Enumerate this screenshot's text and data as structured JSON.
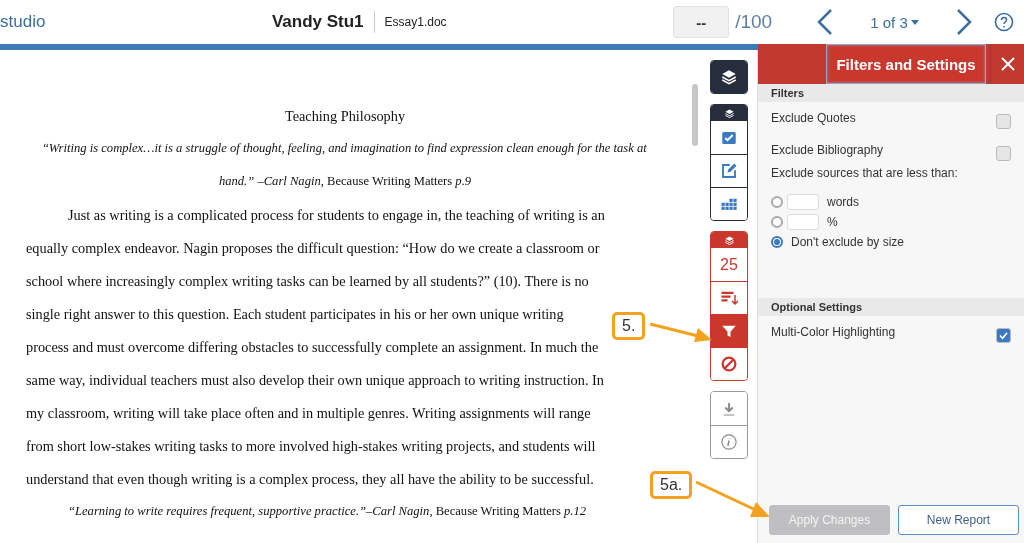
{
  "header": {
    "product": "studio",
    "student": "Vandy Stu1",
    "file": "Essay1.doc",
    "score": "--",
    "score_total": "/100",
    "page": "1 of 3"
  },
  "document": {
    "lines": [
      {
        "kind": "title",
        "text": "Teaching Philosophy"
      },
      {
        "kind": "quote",
        "text": "“*Writing is complex…it is a struggle of thought, feeling, and imagination to find expression clean enough for the task at*"
      },
      {
        "kind": "quote",
        "text": "*hand.” –Carl Nagin*, Because Writing Matters *p.9*"
      },
      {
        "kind": "first",
        "text": "Just as writing is a complicated process for students to engage in, the teaching of writing is an"
      },
      {
        "kind": "body",
        "text": "equally complex endeavor.  Nagin proposes the difficult question: “How do we create a classroom or"
      },
      {
        "kind": "body",
        "text": "school where increasingly complex writing tasks can be learned by all students?” (10).  There is no"
      },
      {
        "kind": "body",
        "text": "single right answer to this question.  Each student participates in his or her own unique writing"
      },
      {
        "kind": "body",
        "text": "process and must overcome differing obstacles to successfully complete an assignment.  In much the"
      },
      {
        "kind": "body",
        "text": "same way, individual teachers must also develop their own unique approach to writing instruction.  In"
      },
      {
        "kind": "body",
        "text": "my classroom, writing will take place often and in multiple genres.  Writing assignments will range"
      },
      {
        "kind": "body",
        "text": "from short low-stakes writing tasks to more involved high-stakes writing projects, and students will"
      },
      {
        "kind": "body",
        "text": "understand that even though writing is a complex process, they all have the ability to be successful."
      },
      {
        "kind": "quote-indent",
        "text": "*“Learning to write requires frequent, supportive practice.”–Carl Nagin*, Because Writing Matters *p.12*"
      }
    ]
  },
  "toolbar": [
    {
      "kind": "dark",
      "header": false,
      "buttons": [
        {
          "selected": false
        }
      ]
    },
    {
      "kind": "dark",
      "header": true,
      "buttons": [
        {
          "selected": false
        },
        {
          "selected": false
        },
        {
          "selected": false
        }
      ]
    },
    {
      "kind": "red",
      "header": true,
      "buttons": [
        {
          "text": "25",
          "selected": false
        },
        {
          "selected": false
        },
        {
          "selected": true
        },
        {
          "selected": false
        }
      ]
    },
    {
      "kind": "plain",
      "header": false,
      "buttons": [
        {
          "selected": false
        },
        {
          "selected": false
        }
      ]
    }
  ],
  "panel": {
    "title": "Filters and Settings",
    "filters_heading": "Filters",
    "checkboxes": [
      {
        "label": "Exclude Quotes",
        "checked": false
      },
      {
        "label": "Exclude Bibliography",
        "checked": false
      }
    ],
    "exclude_label": "Exclude sources that are less than:",
    "radios": [
      {
        "kind": "input",
        "label": "words",
        "selected": false
      },
      {
        "kind": "input",
        "label": "%",
        "selected": false
      },
      {
        "kind": "plain",
        "label": "Don't exclude by size",
        "selected": true
      }
    ],
    "optional_heading": "Optional Settings",
    "optional": [
      {
        "label": "Multi-Color Highlighting",
        "checked": true
      }
    ],
    "buttons": [
      {
        "label": "Apply Changes",
        "disabled": true
      },
      {
        "label": "New Report",
        "disabled": false
      }
    ]
  },
  "callouts": [
    {
      "label": "5."
    },
    {
      "label": "5a."
    }
  ]
}
